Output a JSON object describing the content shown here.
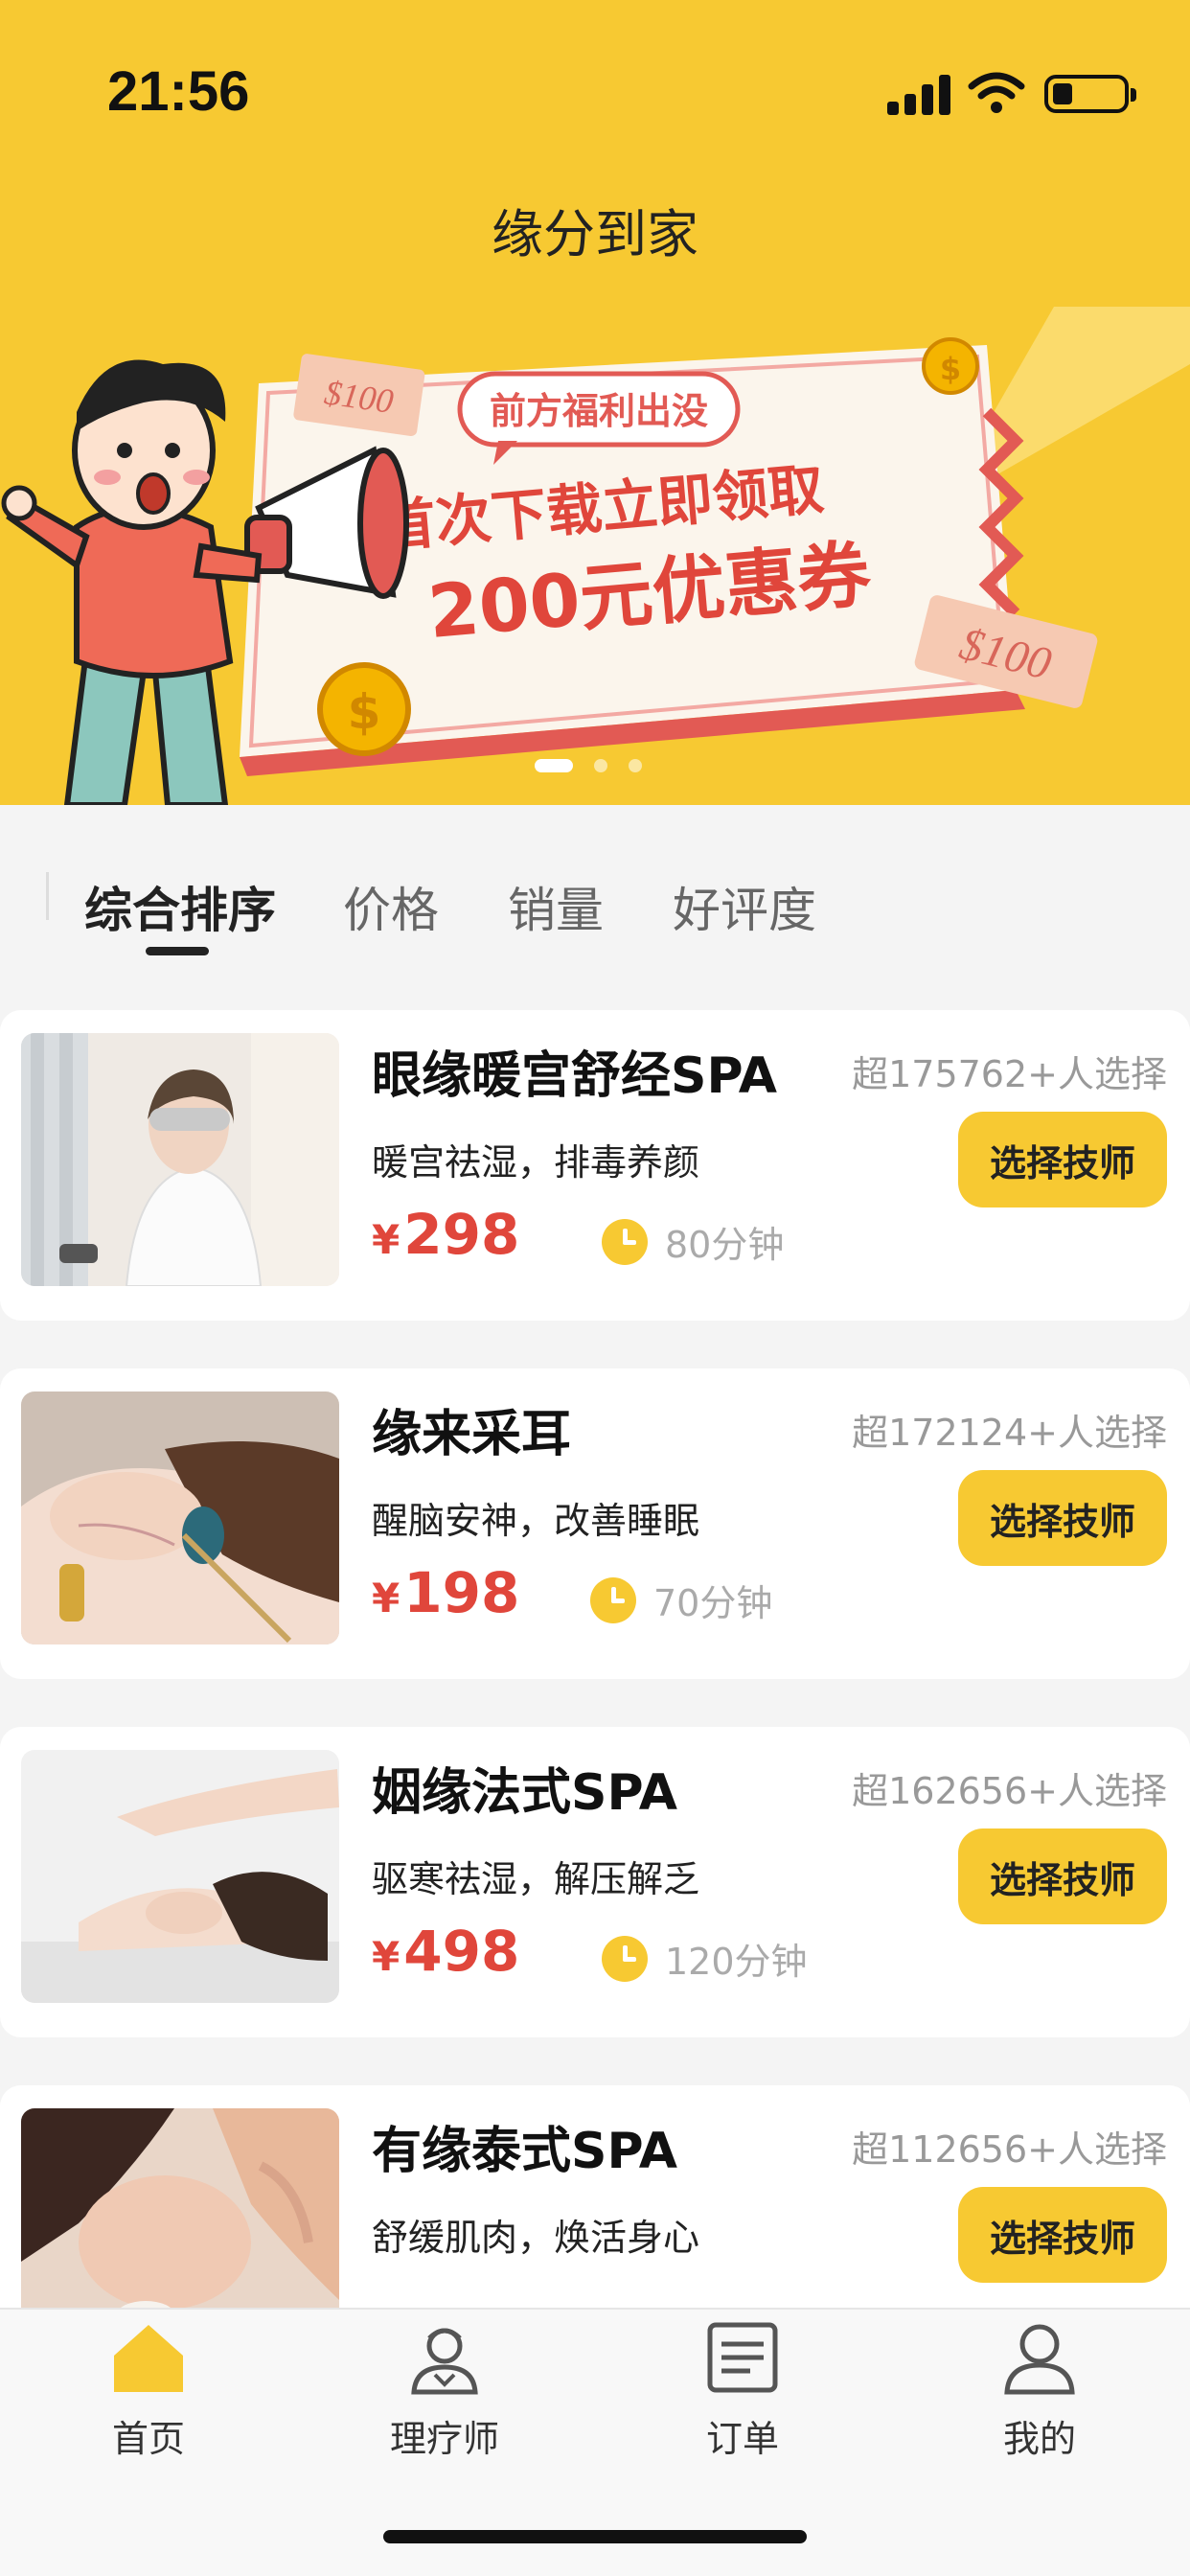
{
  "status_bar": {
    "time": "21:56"
  },
  "header": {
    "title": "缘分到家"
  },
  "banner": {
    "bubble": "前方福利出没",
    "headline_1": "首次下载立即领取",
    "headline_2": "200元优惠券",
    "voucher_left": "$100",
    "voucher_right": "$100",
    "slides": 3,
    "active_slide": 1
  },
  "sort_tabs": [
    {
      "label": "综合排序",
      "active": true
    },
    {
      "label": "价格",
      "active": false
    },
    {
      "label": "销量",
      "active": false
    },
    {
      "label": "好评度",
      "active": false
    }
  ],
  "services": [
    {
      "title": "眼缘暖宫舒经SPA",
      "sold": "超175762+人选择",
      "desc": "暖宫祛湿，排毒养颜",
      "currency": "¥",
      "price": "298",
      "duration": "80分钟",
      "button": "选择技师"
    },
    {
      "title": "缘来采耳",
      "sold": "超172124+人选择",
      "desc": "醒脑安神，改善睡眠",
      "currency": "¥",
      "price": "198",
      "duration": "70分钟",
      "button": "选择技师"
    },
    {
      "title": "姻缘法式SPA",
      "sold": "超162656+人选择",
      "desc": "驱寒祛湿，解压解乏",
      "currency": "¥",
      "price": "498",
      "duration": "120分钟",
      "button": "选择技师"
    },
    {
      "title": "有缘泰式SPA",
      "sold": "超112656+人选择",
      "desc": "舒缓肌肉，焕活身心",
      "currency": "¥",
      "price": "",
      "duration": "",
      "button": "选择技师"
    }
  ],
  "tabbar": [
    {
      "label": "首页",
      "icon": "home-icon",
      "active": true
    },
    {
      "label": "理疗师",
      "icon": "therapist-icon",
      "active": false
    },
    {
      "label": "订单",
      "icon": "order-icon",
      "active": false
    },
    {
      "label": "我的",
      "icon": "profile-icon",
      "active": false
    }
  ],
  "colors": {
    "brand_yellow": "#f7c932",
    "price_red": "#e0463b",
    "muted_gray": "#999999"
  }
}
